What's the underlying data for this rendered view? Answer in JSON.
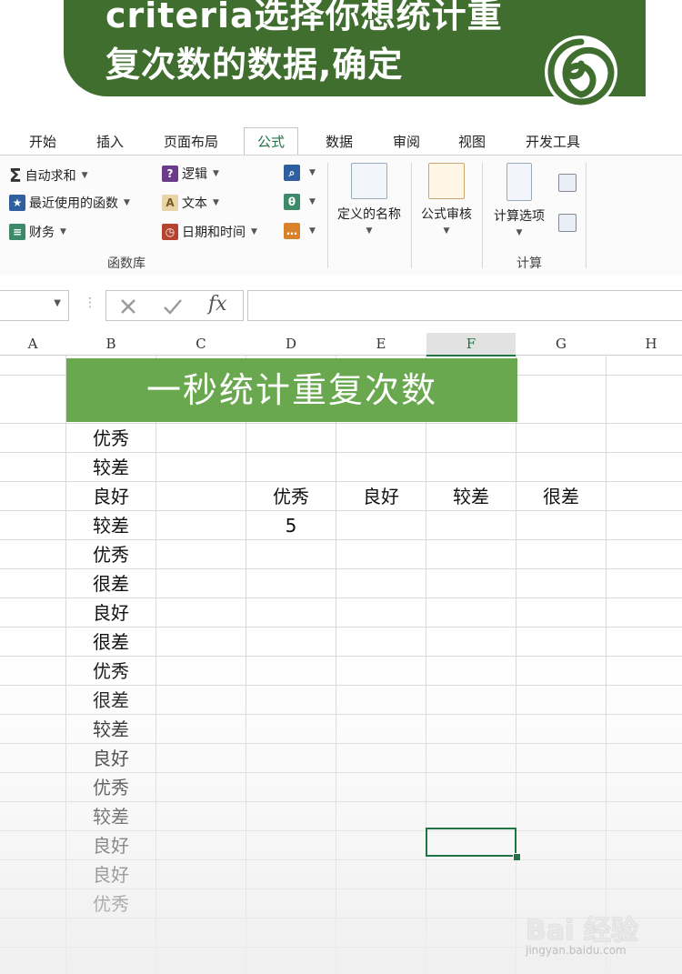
{
  "banner": {
    "line1": "criteria选择你想统计重",
    "line2": "复次数的数据,确定"
  },
  "tabs": [
    "开始",
    "插入",
    "页面布局",
    "公式",
    "数据",
    "审阅",
    "视图",
    "开发工具"
  ],
  "active_tab": "公式",
  "ribbon": {
    "autosum": "自动求和",
    "recent": "最近使用的函数",
    "finance": "财务",
    "logic": "逻辑",
    "text": "文本",
    "datetime": "日期和时间",
    "defined_names": "定义的名称",
    "formula_audit": "公式审核",
    "calc_options": "计算选项",
    "group_functions": "函数库",
    "group_calc": "计算"
  },
  "formula_bar": {
    "fx": "fx",
    "value": ""
  },
  "columns": [
    "A",
    "B",
    "C",
    "D",
    "E",
    "F",
    "G",
    "H"
  ],
  "selected_column": "F",
  "sheet": {
    "title": "一秒统计重复次数",
    "column_b": [
      "优秀",
      "较差",
      "良好",
      "较差",
      "优秀",
      "很差",
      "良好",
      "很差",
      "优秀",
      "很差",
      "较差",
      "良好",
      "优秀",
      "较差",
      "良好",
      "良好",
      "优秀"
    ],
    "summary_headers": [
      "优秀",
      "良好",
      "较差",
      "很差"
    ],
    "summary_values": [
      "5",
      "",
      "",
      ""
    ]
  },
  "watermark": {
    "brand": "Bai 经验",
    "url": "jingyan.baidu.com"
  },
  "colors": {
    "excel_green": "#217346",
    "banner_green": "#3f6e2f",
    "title_green": "#6aa84f"
  }
}
